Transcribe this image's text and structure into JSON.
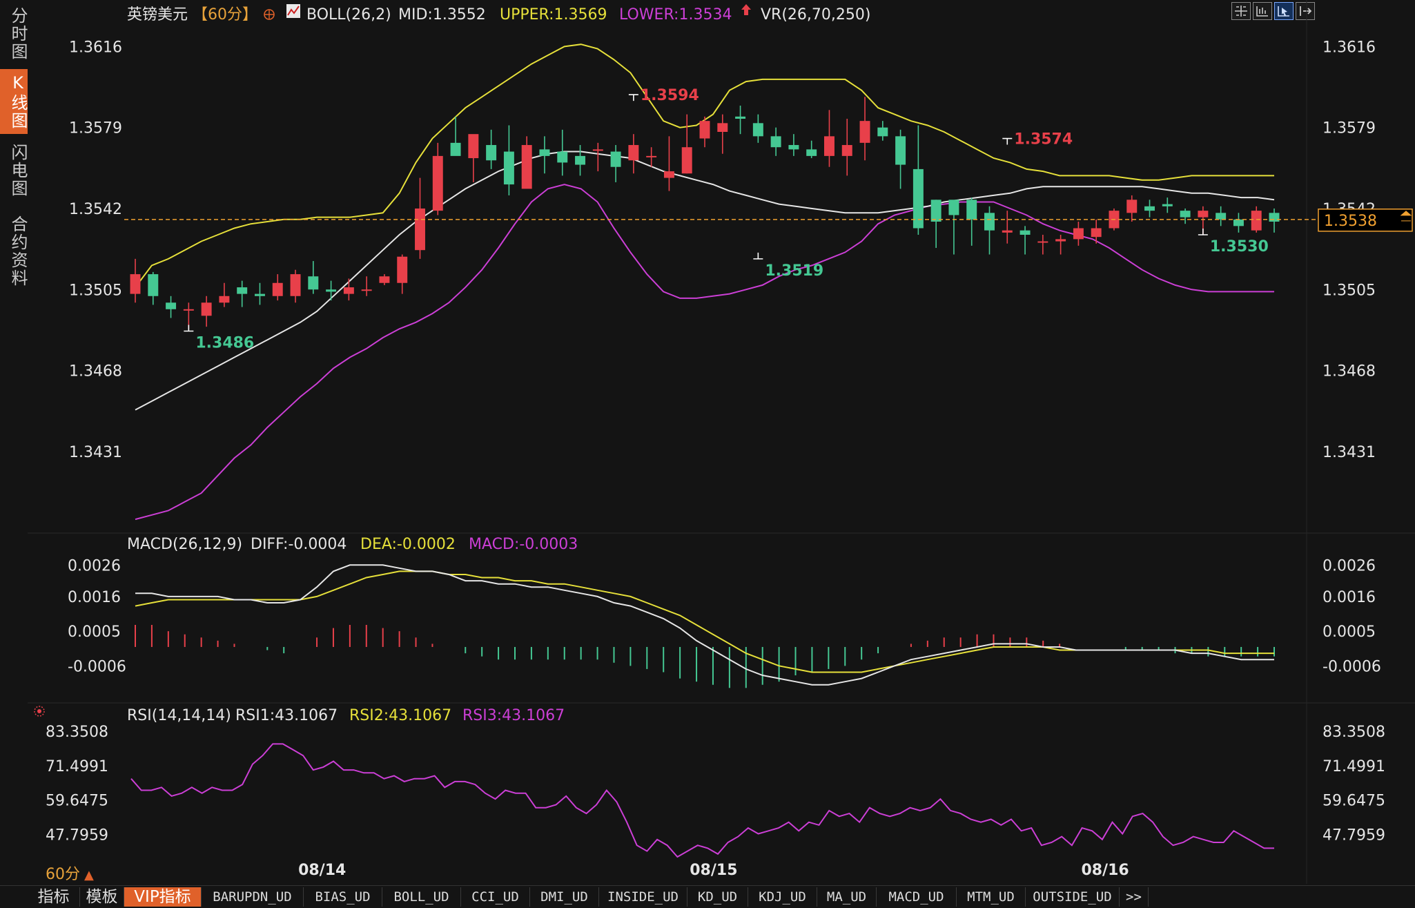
{
  "instrument": {
    "name": "英镑美元",
    "period_tag": "【60分】",
    "currency_icon": "circle-plus-icon"
  },
  "nav": {
    "items": [
      "分时图",
      "K线图",
      "闪电图",
      "合约资料"
    ],
    "active_index": 1
  },
  "tools": [
    {
      "icon": "crosshair-grid-icon",
      "active": false
    },
    {
      "icon": "chart-frame-icon",
      "active": false
    },
    {
      "icon": "cursor-arrow-icon",
      "active": true
    },
    {
      "icon": "exit-arrow-icon",
      "active": false
    }
  ],
  "indicators": {
    "boll": {
      "label": "BOLL(26,2)",
      "mid": "MID:1.3552",
      "upper": "UPPER:1.3569",
      "lower": "LOWER:1.3534"
    },
    "vr": {
      "label": "VR(26,70,250)",
      "icon": "arrow-up-icon"
    },
    "macd": {
      "label": "MACD(26,12,9)",
      "diff": "DIFF:-0.0004",
      "dea": "DEA:-0.0002",
      "macd": "MACD:-0.0003"
    },
    "rsi": {
      "label": "RSI(14,14,14)",
      "rsi1": "RSI1:43.1067",
      "rsi2": "RSI2:43.1067",
      "rsi3": "RSI3:43.1067"
    }
  },
  "colors": {
    "up": "#e8404a",
    "down": "#45c893",
    "upper": "#e6e03a",
    "mid": "#e6e6e6",
    "lower": "#cc3fd6",
    "dea": "#e6e03a",
    "diff": "#e6e6e6",
    "rsi": "#cc3fd6",
    "last_price": "#f0a030",
    "accent": "#e0612a"
  },
  "chart_data": [
    {
      "type": "candlestick",
      "panel": "price",
      "y_ticks": [
        "1.3616",
        "1.3579",
        "1.3542",
        "1.3505",
        "1.3468",
        "1.3431"
      ],
      "ylim": [
        1.3395,
        1.3624
      ],
      "x_labels": [
        "08/14",
        "08/15",
        "08/16"
      ],
      "x_label_bars": [
        10.5,
        32.5,
        54.5
      ],
      "last_price": "1.3538",
      "last_price_value": 1.3537,
      "annotations": [
        {
          "text": "1.3486",
          "bar": 3,
          "value": 1.3486,
          "kind": "low"
        },
        {
          "text": "1.3594",
          "bar": 28,
          "value": 1.3594,
          "kind": "high"
        },
        {
          "text": "1.3519",
          "bar": 35,
          "value": 1.3519,
          "kind": "low"
        },
        {
          "text": "1.3574",
          "bar": 49,
          "value": 1.3574,
          "kind": "high"
        },
        {
          "text": "1.3530",
          "bar": 60,
          "value": 1.353,
          "kind": "low"
        }
      ],
      "candles": [
        [
          1.3503,
          1.3512,
          1.3519,
          1.3499
        ],
        [
          1.3512,
          1.3502,
          1.3513,
          1.3498
        ],
        [
          1.3499,
          1.3496,
          1.3502,
          1.3492
        ],
        [
          1.3496,
          1.3496,
          1.3499,
          1.3487
        ],
        [
          1.3493,
          1.3499,
          1.3502,
          1.3488
        ],
        [
          1.3499,
          1.3502,
          1.3508,
          1.3497
        ],
        [
          1.3506,
          1.3503,
          1.3509,
          1.3497
        ],
        [
          1.3503,
          1.3502,
          1.3508,
          1.3498
        ],
        [
          1.3502,
          1.3508,
          1.3512,
          1.35
        ],
        [
          1.3502,
          1.3512,
          1.3514,
          1.3499
        ],
        [
          1.3511,
          1.3505,
          1.3518,
          1.3503
        ],
        [
          1.3505,
          1.3504,
          1.3509,
          1.35
        ],
        [
          1.3503,
          1.3506,
          1.351,
          1.35
        ],
        [
          1.3505,
          1.3505,
          1.3511,
          1.3502
        ],
        [
          1.3508,
          1.3511,
          1.3512,
          1.3507
        ],
        [
          1.3508,
          1.352,
          1.3521,
          1.3503
        ],
        [
          1.3523,
          1.3542,
          1.3556,
          1.3519
        ],
        [
          1.3541,
          1.3566,
          1.3572,
          1.3539
        ],
        [
          1.3572,
          1.3566,
          1.3584,
          1.3571
        ],
        [
          1.3565,
          1.3576,
          1.3575,
          1.3554
        ],
        [
          1.3571,
          1.3564,
          1.3578,
          1.356
        ],
        [
          1.3568,
          1.3553,
          1.358,
          1.3548
        ],
        [
          1.3551,
          1.3571,
          1.3575,
          1.3555
        ],
        [
          1.3569,
          1.3566,
          1.3575,
          1.3558
        ],
        [
          1.3568,
          1.3563,
          1.3578,
          1.3557
        ],
        [
          1.3566,
          1.3562,
          1.3571,
          1.3557
        ],
        [
          1.3569,
          1.3569,
          1.3572,
          1.3559
        ],
        [
          1.3568,
          1.3561,
          1.3571,
          1.3554
        ],
        [
          1.3564,
          1.3571,
          1.3576,
          1.3558
        ],
        [
          1.3566,
          1.3566,
          1.357,
          1.3561
        ],
        [
          1.3556,
          1.3559,
          1.3575,
          1.355
        ],
        [
          1.3558,
          1.357,
          1.3585,
          1.3558
        ],
        [
          1.3574,
          1.3582,
          1.3584,
          1.357
        ],
        [
          1.3577,
          1.3581,
          1.3585,
          1.3567
        ],
        [
          1.3584,
          1.3583,
          1.3589,
          1.3576
        ],
        [
          1.3581,
          1.3575,
          1.3585,
          1.3572
        ],
        [
          1.3575,
          1.357,
          1.3579,
          1.3566
        ],
        [
          1.3571,
          1.3569,
          1.3576,
          1.3566
        ],
        [
          1.3569,
          1.3566,
          1.3573,
          1.3565
        ],
        [
          1.3566,
          1.3575,
          1.3587,
          1.3561
        ],
        [
          1.3566,
          1.3571,
          1.3583,
          1.3557
        ],
        [
          1.3572,
          1.3582,
          1.3593,
          1.3564
        ],
        [
          1.3579,
          1.3575,
          1.3582,
          1.3573
        ],
        [
          1.3575,
          1.3562,
          1.3578,
          1.3551
        ],
        [
          1.356,
          1.3533,
          1.358,
          1.353
        ],
        [
          1.3546,
          1.3536,
          1.3546,
          1.3524
        ],
        [
          1.3546,
          1.3539,
          1.3545,
          1.3521
        ],
        [
          1.3546,
          1.3537,
          1.3547,
          1.3525
        ],
        [
          1.354,
          1.3532,
          1.3543,
          1.3521
        ],
        [
          1.3531,
          1.3532,
          1.3541,
          1.3526
        ],
        [
          1.3532,
          1.353,
          1.3534,
          1.3521
        ],
        [
          1.3527,
          1.3527,
          1.353,
          1.3521
        ],
        [
          1.3527,
          1.3528,
          1.353,
          1.3521
        ],
        [
          1.3528,
          1.3533,
          1.3536,
          1.3525
        ],
        [
          1.3529,
          1.3533,
          1.3537,
          1.3526
        ],
        [
          1.3533,
          1.3541,
          1.3542,
          1.3532
        ],
        [
          1.354,
          1.3546,
          1.3548,
          1.3536
        ],
        [
          1.3543,
          1.3541,
          1.3546,
          1.3538
        ],
        [
          1.3544,
          1.3543,
          1.3547,
          1.354
        ],
        [
          1.3541,
          1.3538,
          1.3542,
          1.3535
        ],
        [
          1.3538,
          1.3541,
          1.3543,
          1.353
        ],
        [
          1.354,
          1.3537,
          1.3543,
          1.3534
        ],
        [
          1.3537,
          1.3534,
          1.354,
          1.3531
        ],
        [
          1.3532,
          1.3541,
          1.3543,
          1.3531
        ],
        [
          1.354,
          1.3536,
          1.3542,
          1.3531
        ]
      ],
      "upper": [
        1.3506,
        1.3516,
        1.3519,
        1.3523,
        1.3527,
        1.353,
        1.3533,
        1.3535,
        1.3536,
        1.3537,
        1.3537,
        1.3538,
        1.3538,
        1.3538,
        1.3539,
        1.354,
        1.3549,
        1.3563,
        1.3574,
        1.3581,
        1.3588,
        1.3593,
        1.3598,
        1.3603,
        1.3608,
        1.3612,
        1.3616,
        1.3617,
        1.3615,
        1.361,
        1.3604,
        1.3593,
        1.3582,
        1.3579,
        1.358,
        1.3585,
        1.3596,
        1.36,
        1.3601,
        1.3601,
        1.3601,
        1.3601,
        1.3601,
        1.3601,
        1.3596,
        1.3588,
        1.3585,
        1.3582,
        1.358,
        1.3577,
        1.3573,
        1.3569,
        1.3565,
        1.3563,
        1.356,
        1.3559,
        1.3557,
        1.3557,
        1.3557,
        1.3557,
        1.3556,
        1.3555,
        1.3555,
        1.3556,
        1.3557,
        1.3557,
        1.3557,
        1.3557,
        1.3557,
        1.3557
      ],
      "mid": [
        1.345,
        1.3454,
        1.3458,
        1.3462,
        1.3466,
        1.347,
        1.3474,
        1.3478,
        1.3482,
        1.3486,
        1.349,
        1.3495,
        1.3502,
        1.3509,
        1.3516,
        1.3523,
        1.353,
        1.3536,
        1.3541,
        1.3546,
        1.3551,
        1.3555,
        1.3559,
        1.3562,
        1.3565,
        1.3567,
        1.3568,
        1.3568,
        1.3567,
        1.3566,
        1.3565,
        1.3562,
        1.3559,
        1.3557,
        1.3555,
        1.3553,
        1.355,
        1.3548,
        1.3546,
        1.3544,
        1.3543,
        1.3542,
        1.3541,
        1.354,
        1.354,
        1.354,
        1.3541,
        1.3542,
        1.3543,
        1.3545,
        1.3546,
        1.3547,
        1.3548,
        1.3549,
        1.3551,
        1.3552,
        1.3552,
        1.3552,
        1.3552,
        1.3552,
        1.3552,
        1.3552,
        1.3551,
        1.355,
        1.3549,
        1.3549,
        1.3548,
        1.3547,
        1.3547,
        1.3546
      ],
      "lower": [
        1.34,
        1.3402,
        1.3404,
        1.3408,
        1.3412,
        1.342,
        1.3428,
        1.3434,
        1.3442,
        1.3449,
        1.3456,
        1.3462,
        1.3469,
        1.3474,
        1.3478,
        1.3483,
        1.3487,
        1.349,
        1.3494,
        1.3499,
        1.3506,
        1.3514,
        1.3524,
        1.3535,
        1.3545,
        1.3551,
        1.3553,
        1.3551,
        1.3545,
        1.3533,
        1.3522,
        1.3512,
        1.3504,
        1.3501,
        1.3501,
        1.3502,
        1.3503,
        1.3505,
        1.3507,
        1.3511,
        1.3514,
        1.3516,
        1.3519,
        1.3522,
        1.3527,
        1.3535,
        1.3539,
        1.3541,
        1.3543,
        1.3544,
        1.3545,
        1.3545,
        1.3545,
        1.3542,
        1.3539,
        1.3535,
        1.3532,
        1.353,
        1.3528,
        1.3524,
        1.3519,
        1.3514,
        1.351,
        1.3507,
        1.3505,
        1.3504,
        1.3504,
        1.3504,
        1.3504,
        1.3504
      ]
    },
    {
      "type": "macd",
      "panel": "macd",
      "y_ticks": [
        "0.0026",
        "0.0016",
        "0.0005",
        "-0.0006"
      ],
      "ylim": [
        -0.0016,
        0.003
      ],
      "diff": [
        0.0017,
        0.0017,
        0.0016,
        0.0016,
        0.0016,
        0.0016,
        0.0015,
        0.0015,
        0.0014,
        0.0014,
        0.0015,
        0.0019,
        0.0024,
        0.0026,
        0.0026,
        0.0026,
        0.0025,
        0.0024,
        0.0024,
        0.0023,
        0.0021,
        0.0021,
        0.002,
        0.002,
        0.0019,
        0.0019,
        0.0018,
        0.0017,
        0.0016,
        0.0014,
        0.0013,
        0.0011,
        0.0009,
        0.0006,
        0.0002,
        -0.0001,
        -0.0004,
        -0.0007,
        -0.0009,
        -0.001,
        -0.0011,
        -0.0012,
        -0.0012,
        -0.0011,
        -0.001,
        -0.0008,
        -0.0006,
        -0.0004,
        -0.0003,
        -0.0002,
        -0.0001,
        0.0,
        0.0001,
        0.0001,
        0.0001,
        0.0,
        0.0,
        -0.0001,
        -0.0001,
        -0.0001,
        -0.0001,
        -0.0001,
        -0.0001,
        -0.0001,
        -0.0002,
        -0.0002,
        -0.0003,
        -0.0004,
        -0.0004,
        -0.0004
      ],
      "dea": [
        0.0013,
        0.0014,
        0.0015,
        0.0015,
        0.0015,
        0.0015,
        0.0015,
        0.0015,
        0.0015,
        0.0015,
        0.0015,
        0.0016,
        0.0018,
        0.002,
        0.0022,
        0.0023,
        0.0024,
        0.0024,
        0.0024,
        0.0023,
        0.0023,
        0.0022,
        0.0022,
        0.0021,
        0.0021,
        0.002,
        0.002,
        0.0019,
        0.0018,
        0.0017,
        0.0016,
        0.0014,
        0.0012,
        0.001,
        0.0007,
        0.0004,
        0.0001,
        -0.0002,
        -0.0004,
        -0.0006,
        -0.0007,
        -0.0008,
        -0.0008,
        -0.0008,
        -0.0008,
        -0.0007,
        -0.0006,
        -0.0005,
        -0.0004,
        -0.0003,
        -0.0002,
        -0.0001,
        0.0,
        0.0,
        0.0,
        0.0,
        -0.0001,
        -0.0001,
        -0.0001,
        -0.0001,
        -0.0001,
        -0.0001,
        -0.0001,
        -0.0001,
        -0.0001,
        -0.0001,
        -0.0002,
        -0.0002,
        -0.0002,
        -0.0002
      ],
      "hist": [
        0.0007,
        0.0007,
        0.0005,
        0.0004,
        0.0003,
        0.0002,
        0.0001,
        0.0,
        -0.0001,
        -0.0002,
        0.0,
        0.0003,
        0.0006,
        0.0007,
        0.0007,
        0.0006,
        0.0005,
        0.0003,
        0.0001,
        0.0,
        -0.0002,
        -0.0003,
        -0.0004,
        -0.0004,
        -0.0004,
        -0.0004,
        -0.0004,
        -0.0004,
        -0.0004,
        -0.0005,
        -0.0006,
        -0.0007,
        -0.0008,
        -0.001,
        -0.0011,
        -0.0012,
        -0.0013,
        -0.0013,
        -0.0012,
        -0.0011,
        -0.0009,
        -0.0008,
        -0.0007,
        -0.0006,
        -0.0004,
        -0.0002,
        0.0,
        0.0001,
        0.0002,
        0.0003,
        0.0003,
        0.0004,
        0.0004,
        0.0003,
        0.0003,
        0.0002,
        0.0001,
        0.0,
        0.0,
        0.0,
        -0.0001,
        -0.0001,
        -0.0001,
        -0.0002,
        -0.0002,
        -0.0003,
        -0.0003,
        -0.0003,
        -0.0003,
        -0.0003
      ]
    },
    {
      "type": "line",
      "panel": "rsi",
      "y_ticks": [
        "83.3508",
        "71.4991",
        "59.6475",
        "47.7959"
      ],
      "ylim": [
        35,
        86
      ],
      "rsi": [
        67,
        63,
        63,
        64,
        61,
        62,
        64,
        62,
        64,
        63,
        63,
        65,
        72,
        75,
        79,
        79,
        77,
        75,
        70,
        71,
        73,
        70,
        70,
        69,
        69,
        67,
        68,
        66,
        67,
        67,
        68,
        64,
        66,
        66,
        65,
        62,
        60,
        63,
        62,
        62,
        57,
        57,
        58,
        61,
        57,
        55,
        58,
        63,
        59,
        52,
        44,
        42,
        46,
        44,
        40,
        42,
        44,
        43,
        41,
        45,
        47,
        50,
        48,
        49,
        50,
        52,
        49,
        52,
        51,
        56,
        54,
        55,
        52,
        57,
        55,
        54,
        55,
        57,
        56,
        57,
        60,
        56,
        55,
        53,
        52,
        53,
        51,
        53,
        49,
        50,
        44,
        45,
        47,
        44,
        50,
        49,
        46,
        52,
        48,
        54,
        55,
        52,
        47,
        44,
        45,
        47,
        46,
        45,
        45,
        49,
        47,
        45,
        43,
        43
      ]
    }
  ],
  "period_selector": {
    "label": "60分",
    "icon": "triangle-up-icon"
  },
  "tabs": [
    "指标",
    "模板",
    "VIP指标",
    "BARUPDN_UD",
    "BIAS_UD",
    "BOLL_UD",
    "CCI_UD",
    "DMI_UD",
    "INSIDE_UD",
    "KD_UD",
    "KDJ_UD",
    "MA_UD",
    "MACD_UD",
    "MTM_UD",
    "OUTSIDE_UD",
    ">>"
  ],
  "active_tab_index": 2
}
